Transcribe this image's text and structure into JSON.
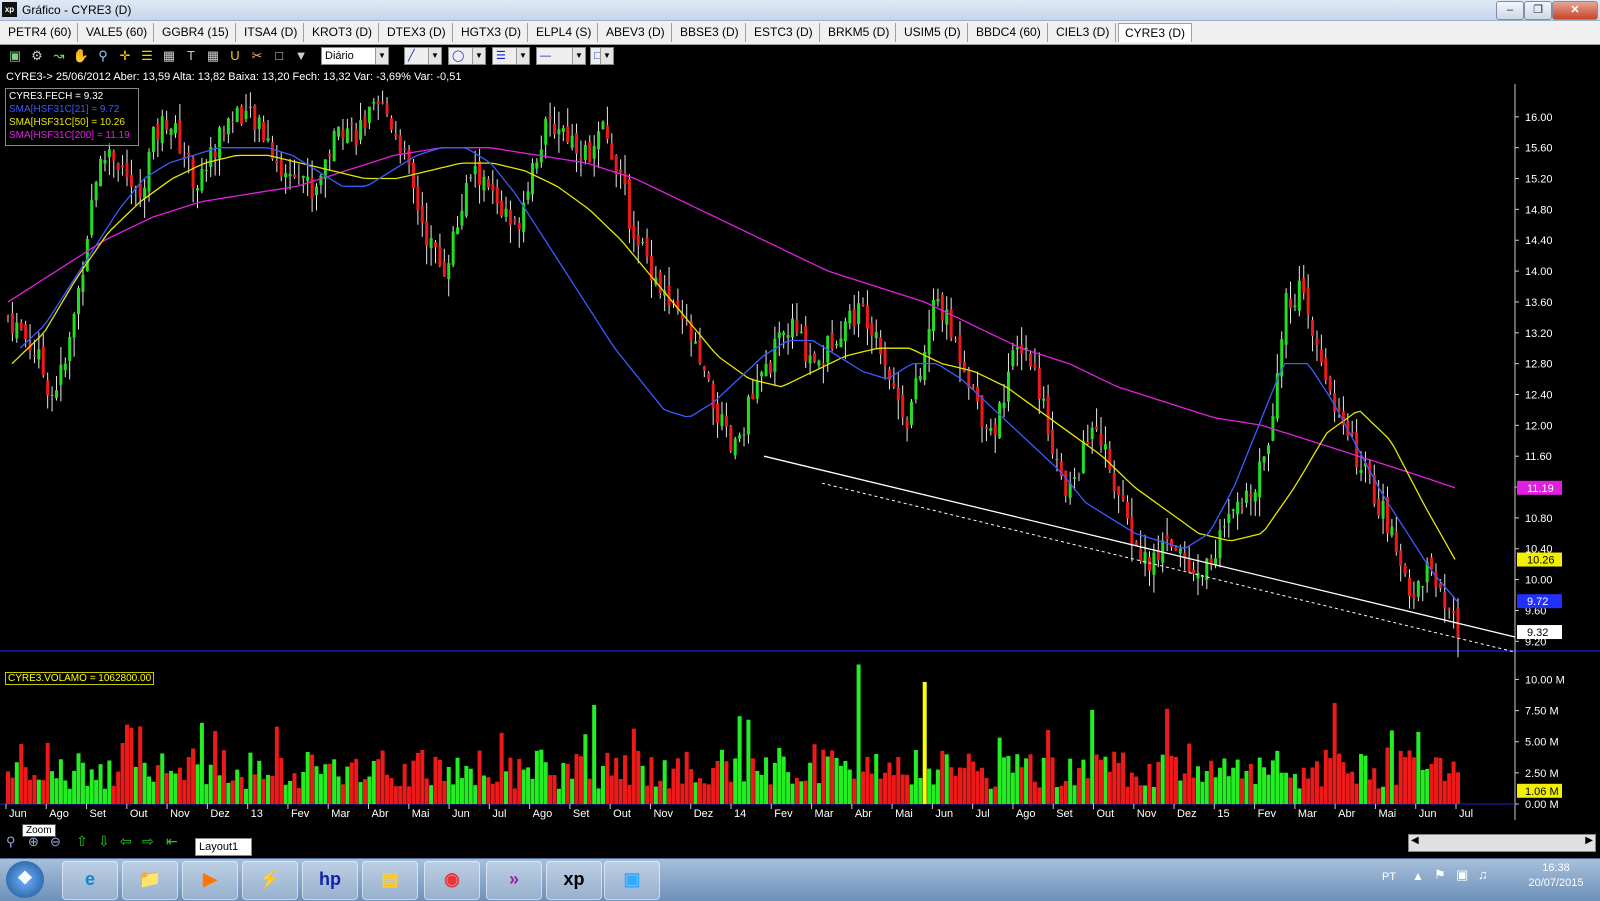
{
  "window": {
    "title": "Gráfico - CYRE3 (D)",
    "logo": "xp"
  },
  "tabs": [
    "PETR4 (60)",
    "VALE5 (60)",
    "GGBR4 (15)",
    "ITSA4 (D)",
    "KROT3 (D)",
    "DTEX3 (D)",
    "HGTX3 (D)",
    "ELPL4 (S)",
    "ABEV3 (D)",
    "BBSE3 (D)",
    "ESTC3 (D)",
    "BRKM5 (D)",
    "USIM5 (D)",
    "BBDC4 (60)",
    "CIEL3 (D)",
    "CYRE3 (D)"
  ],
  "active_tab": "CYRE3 (D)",
  "toolbar": {
    "icons": [
      "chart-icon",
      "gear-icon",
      "line-tool-icon",
      "hand-icon",
      "magnifier-icon",
      "crosshair-icon",
      "fibonacci-icon",
      "grid-icon",
      "text-icon",
      "calculator-icon",
      "magnet-icon",
      "eraser-icon",
      "lock-icon",
      "filter-icon"
    ],
    "period": "Diário"
  },
  "quote_info": "CYRE3-> 25/06/2012 Aber: 13,59 Alta: 13,82 Baixa: 13,20 Fech: 13,32 Var: -3,69% Var: -0,51",
  "indicators": {
    "close": {
      "label": "CYRE3.FECH = 9.32",
      "color": "#ffffff"
    },
    "sma21": {
      "label": "SMA[HSF31C[21] = 9.72",
      "color": "#3b5bff"
    },
    "sma50": {
      "label": "SMA[HSF31C[50] = 10.26",
      "color": "#e6e600"
    },
    "sma200": {
      "label": "SMA[HSF31C[200] = 11.19",
      "color": "#e020e0"
    }
  },
  "price_tags": [
    {
      "value": "11.19",
      "color": "#e020e0",
      "text_color": "#ffffff"
    },
    {
      "value": "10.26",
      "color": "#f0f000",
      "text_color": "#000000"
    },
    {
      "value": "9.72",
      "color": "#2030ff",
      "text_color": "#ffffff"
    },
    {
      "value": "9.32",
      "color": "#ffffff",
      "text_color": "#000000"
    }
  ],
  "volume": {
    "label": "CYRE3.VOLAMO = 1062800.00",
    "tag": "1.06 M"
  },
  "chart_data": {
    "type": "candlestick",
    "price_axis": [
      "16.00",
      "15.60",
      "15.20",
      "14.80",
      "14.40",
      "14.00",
      "13.60",
      "13.20",
      "12.80",
      "12.40",
      "12.00",
      "11.60",
      "11.20",
      "10.80",
      "10.40",
      "10.00",
      "9.60",
      "9.20"
    ],
    "ylim": [
      9.1,
      16.4
    ],
    "volume_axis": [
      "10.00 M",
      "7.50 M",
      "5.00 M",
      "2.50 M",
      "0.00 M"
    ],
    "x_labels": [
      "Jun",
      "Ago",
      "Set",
      "Out",
      "Nov",
      "Dez",
      "13",
      "Fev",
      "Mar",
      "Abr",
      "Mai",
      "Jun",
      "Jul",
      "Ago",
      "Set",
      "Out",
      "Nov",
      "Dez",
      "14",
      "Fev",
      "Mar",
      "Abr",
      "Mai",
      "Jun",
      "Jul",
      "Ago",
      "Set",
      "Out",
      "Nov",
      "Dez",
      "15",
      "Fev",
      "Mar",
      "Abr",
      "Mai",
      "Jun",
      "Jul"
    ],
    "price_series": [
      13.4,
      13.2,
      12.9,
      12.4,
      12.8,
      13.9,
      15.2,
      15.6,
      15.3,
      14.9,
      15.7,
      16.0,
      15.6,
      15.1,
      15.5,
      15.9,
      16.1,
      15.9,
      15.7,
      15.2,
      15.4,
      15.0,
      15.5,
      15.9,
      15.8,
      16.0,
      16.1,
      15.7,
      15.0,
      14.4,
      14.0,
      14.6,
      15.3,
      15.1,
      14.8,
      14.5,
      15.3,
      15.8,
      15.9,
      15.7,
      15.5,
      15.8,
      15.4,
      14.6,
      14.2,
      13.8,
      13.4,
      13.2,
      12.6,
      12.1,
      11.6,
      12.2,
      12.6,
      13.0,
      13.3,
      13.0,
      12.8,
      13.2,
      13.4,
      13.5,
      13.2,
      12.5,
      12.1,
      12.7,
      13.7,
      13.2,
      12.8,
      12.2,
      11.9,
      12.7,
      13.1,
      12.6,
      11.8,
      11.0,
      11.6,
      12.0,
      11.5,
      10.8,
      10.3,
      10.2,
      10.6,
      10.3,
      10.0,
      10.3,
      10.7,
      10.9,
      11.3,
      11.9,
      13.5,
      13.8,
      13.1,
      12.6,
      12.0,
      11.6,
      11.2,
      10.8,
      10.2,
      9.8,
      10.2,
      9.6,
      9.3
    ],
    "sma21": [
      13.0,
      13.3,
      13.8,
      14.3,
      14.8,
      15.2,
      15.4,
      15.5,
      15.6,
      15.6,
      15.6,
      15.5,
      15.3,
      15.1,
      15.1,
      15.3,
      15.5,
      15.6,
      15.6,
      15.4,
      15.0,
      14.5,
      14.0,
      13.5,
      13.0,
      12.6,
      12.2,
      12.1,
      12.3,
      12.6,
      12.9,
      13.1,
      13.1,
      12.9,
      12.7,
      12.6,
      12.8,
      12.8,
      12.6,
      12.3,
      12.0,
      11.7,
      11.4,
      11.0,
      10.8,
      10.6,
      10.5,
      10.4,
      10.6,
      11.2,
      12.0,
      12.8,
      12.8,
      12.3,
      11.7,
      11.1,
      10.6,
      10.1,
      9.72
    ],
    "sma50": [
      12.8,
      13.2,
      13.9,
      14.5,
      14.9,
      15.2,
      15.4,
      15.5,
      15.5,
      15.4,
      15.3,
      15.2,
      15.2,
      15.3,
      15.4,
      15.4,
      15.3,
      15.1,
      14.8,
      14.4,
      13.9,
      13.4,
      12.9,
      12.6,
      12.5,
      12.7,
      12.9,
      13.0,
      13.0,
      12.8,
      12.7,
      12.5,
      12.2,
      11.9,
      11.6,
      11.2,
      10.9,
      10.6,
      10.5,
      10.6,
      11.2,
      11.9,
      12.2,
      11.8,
      11.0,
      10.26
    ],
    "sma200": [
      13.6,
      14.0,
      14.4,
      14.7,
      14.9,
      15.0,
      15.1,
      15.3,
      15.5,
      15.6,
      15.6,
      15.5,
      15.4,
      15.2,
      14.9,
      14.6,
      14.3,
      14.0,
      13.8,
      13.6,
      13.3,
      13.0,
      12.8,
      12.5,
      12.3,
      12.1,
      12.0,
      11.8,
      11.6,
      11.4,
      11.19
    ],
    "trendline": {
      "from_date": "Mar 2014",
      "from_value": 11.6,
      "to_date": "Jul 2015",
      "to_value": 9.1
    }
  },
  "bottom": {
    "zoom_tip": "Zoom",
    "layout_tab": "Layout1"
  },
  "taskbar": {
    "lang": "PT",
    "time": "16:38",
    "date": "20/07/2015",
    "items": [
      "start-orb-icon",
      "ie-icon",
      "explorer-icon",
      "media-icon",
      "network-icon",
      "hp-icon",
      "briefcase-icon",
      "chrome-icon",
      "xp-app-icon",
      "xp-trade-icon",
      "picture-icon"
    ]
  }
}
